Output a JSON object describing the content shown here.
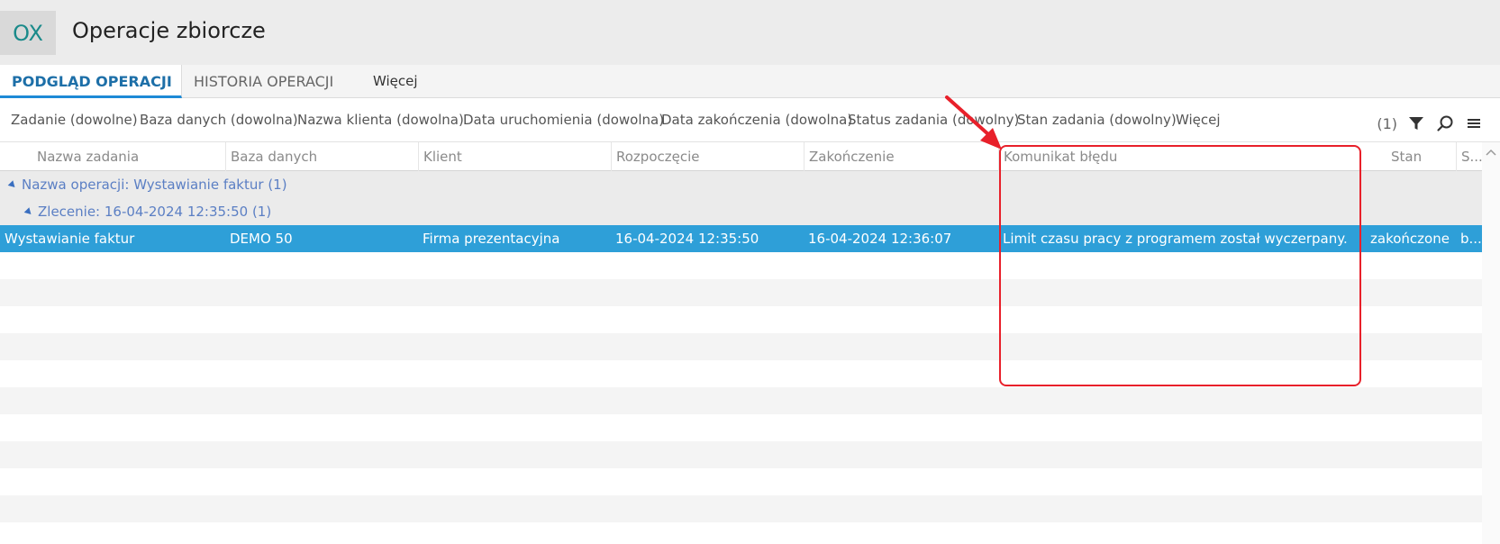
{
  "app": {
    "logo": "OX",
    "title": "Operacje zbiorcze"
  },
  "tabs": [
    {
      "label": "PODGLĄD OPERACJI",
      "active": true
    },
    {
      "label": "HISTORIA OPERACJI",
      "active": false
    },
    {
      "label": "Więcej",
      "active": false
    }
  ],
  "filters": [
    "Zadanie (dowolne)",
    "Baza danych (dowolna)",
    "Nazwa klienta (dowolna)",
    "Data uruchomienia (dowolna)",
    "Data zakończenia (dowolna)",
    "Status zadania (dowolny)",
    "Stan zadania (dowolny)",
    "Więcej"
  ],
  "toolbar": {
    "count": "(1)",
    "filter_icon": "filter-icon",
    "search_icon": "search-icon",
    "menu_icon": "menu-icon"
  },
  "columns": [
    "Nazwa zadania",
    "Baza danych",
    "Klient",
    "Rozpoczęcie",
    "Zakończenie",
    "Komunikat błędu",
    "Stan",
    "S..."
  ],
  "groups": {
    "operation": "Nazwa operacji: Wystawianie faktur (1)",
    "order": "Zlecenie: 16-04-2024 12:35:50 (1)"
  },
  "rows": [
    {
      "task": "Wystawianie faktur",
      "database": "DEMO 50",
      "client": "Firma prezentacyjna",
      "start": "16-04-2024 12:35:50",
      "end": "16-04-2024 12:36:07",
      "error": "Limit czasu pracy z programem został wyczerpany.",
      "state": "zakończone",
      "status": "b..."
    }
  ],
  "colors": {
    "accent": "#1d8ad6",
    "selected_row": "#2e9fd8",
    "annotation": "#e8202a"
  }
}
